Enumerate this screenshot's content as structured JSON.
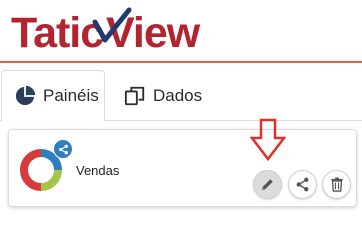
{
  "brand": {
    "name_part1": "Tatic",
    "name_part2": "View",
    "color_dark": "#b2242f",
    "color_accent": "#e8623d",
    "color_navy": "#1f3a6e"
  },
  "tabs": [
    {
      "label": "Painéis",
      "icon": "pie-chart-icon",
      "active": true
    },
    {
      "label": "Dados",
      "icon": "copy-icon",
      "active": false
    }
  ],
  "card": {
    "title": "Vendas",
    "thumbnail": "donut-chart-icon",
    "shared_badge_icon": "share-icon",
    "actions": [
      {
        "name": "edit",
        "icon": "pencil-icon"
      },
      {
        "name": "share",
        "icon": "share-icon"
      },
      {
        "name": "delete",
        "icon": "trash-icon"
      }
    ]
  },
  "annotation": {
    "icon": "down-arrow-icon",
    "color": "#e0312b"
  },
  "colors": {
    "donut": [
      "#2f7fbf",
      "#d63b3b",
      "#a3c64a",
      "#e6e6e6"
    ],
    "badge": "#2f7fbf"
  }
}
